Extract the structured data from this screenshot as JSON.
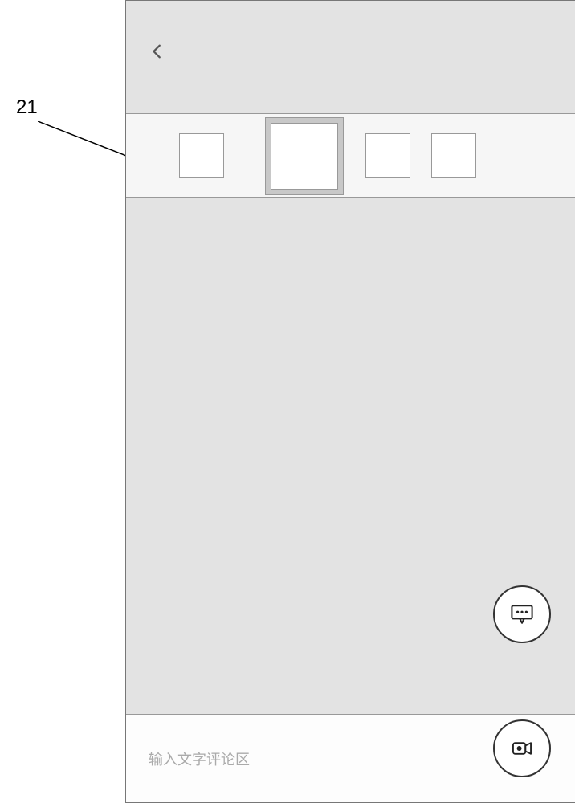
{
  "callout": {
    "label": "21"
  },
  "header": {
    "back_icon_name": "chevron-left-icon"
  },
  "carousel": {
    "items": [
      {
        "type": "small"
      },
      {
        "type": "center-selected"
      },
      {
        "type": "small"
      },
      {
        "type": "small"
      }
    ]
  },
  "fab": {
    "comment_icon": "comment-bubble-icon",
    "video_icon": "video-camera-icon"
  },
  "bottom": {
    "placeholder": "输入文字评论区"
  }
}
